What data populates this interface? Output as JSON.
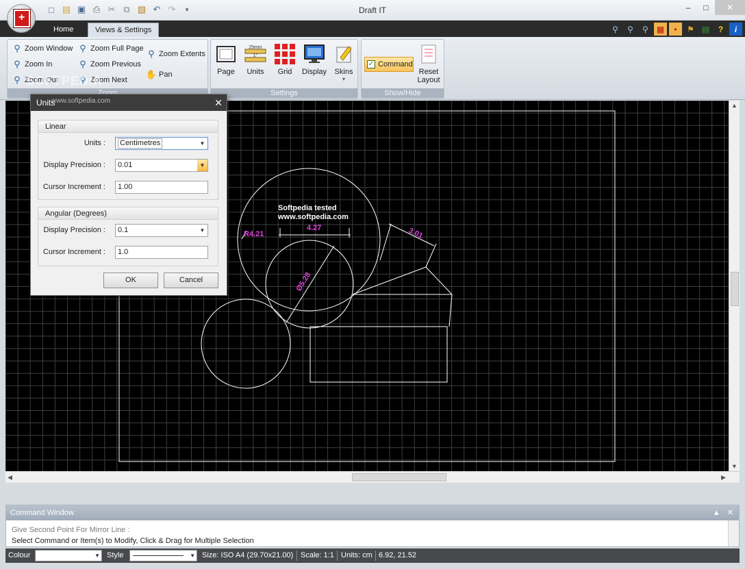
{
  "window": {
    "title": "Draft IT"
  },
  "quick_access": [
    "new-icon",
    "open-icon",
    "save-icon",
    "print-icon",
    "cut-icon",
    "copy-icon",
    "paste-icon",
    "undo-icon",
    "redo-icon"
  ],
  "tabs": [
    {
      "label": "Home",
      "active": false
    },
    {
      "label": "Views & Settings",
      "active": true
    }
  ],
  "ribbon": {
    "zoom": {
      "label": "Zoom",
      "buttons": [
        "Zoom Window",
        "Zoom Full Page",
        "Zoom Extents",
        "Zoom In",
        "Zoom Previous",
        "Pan",
        "Zoom Out",
        "Zoom Next"
      ]
    },
    "settings": {
      "label": "Settings",
      "buttons": [
        "Page",
        "Units",
        "Grid",
        "Display",
        "Skins"
      ],
      "units_icon_text": [
        "25mm",
        "1\""
      ]
    },
    "showhide": {
      "label": "Show/Hide",
      "command_label": "Command",
      "reset_label_1": "Reset",
      "reset_label_2": "Layout"
    }
  },
  "watermark": {
    "text": "SOFTPEDIA",
    "url": "www.softpedia.com"
  },
  "drawing": {
    "text_line_1": "Softpedia tested",
    "text_line_2": "www.softpedia.com",
    "dim_radius": "R4.21",
    "dim_width": "4.27",
    "dim_angled": "3.01",
    "dim_diameter": "Ø5.28",
    "accent_color": "#e040e0"
  },
  "dialog": {
    "title": "Units",
    "linear": {
      "header": "Linear",
      "units_label": "Units :",
      "units_value": "Centimetres",
      "precision_label": "Display Precision :",
      "precision_value": "0.01",
      "increment_label": "Cursor Increment :",
      "increment_value": "1.00"
    },
    "angular": {
      "header": "Angular (Degrees)",
      "precision_label": "Display Precision :",
      "precision_value": "0.1",
      "increment_label": "Cursor Increment :",
      "increment_value": "1.0"
    },
    "ok_label": "OK",
    "cancel_label": "Cancel"
  },
  "command_window": {
    "title": "Command Window",
    "prompt": "Give Second Point For Mirror Line :",
    "hint": "Select Command or Item(s) to Modify, Click & Drag for Multiple Selection"
  },
  "statusbar": {
    "colour_label": "Colour",
    "style_label": "Style",
    "size": "Size: ISO A4 (29.70x21.00)",
    "scale": "Scale: 1:1",
    "units": "Units: cm",
    "coords": "6.92, 21.52"
  }
}
